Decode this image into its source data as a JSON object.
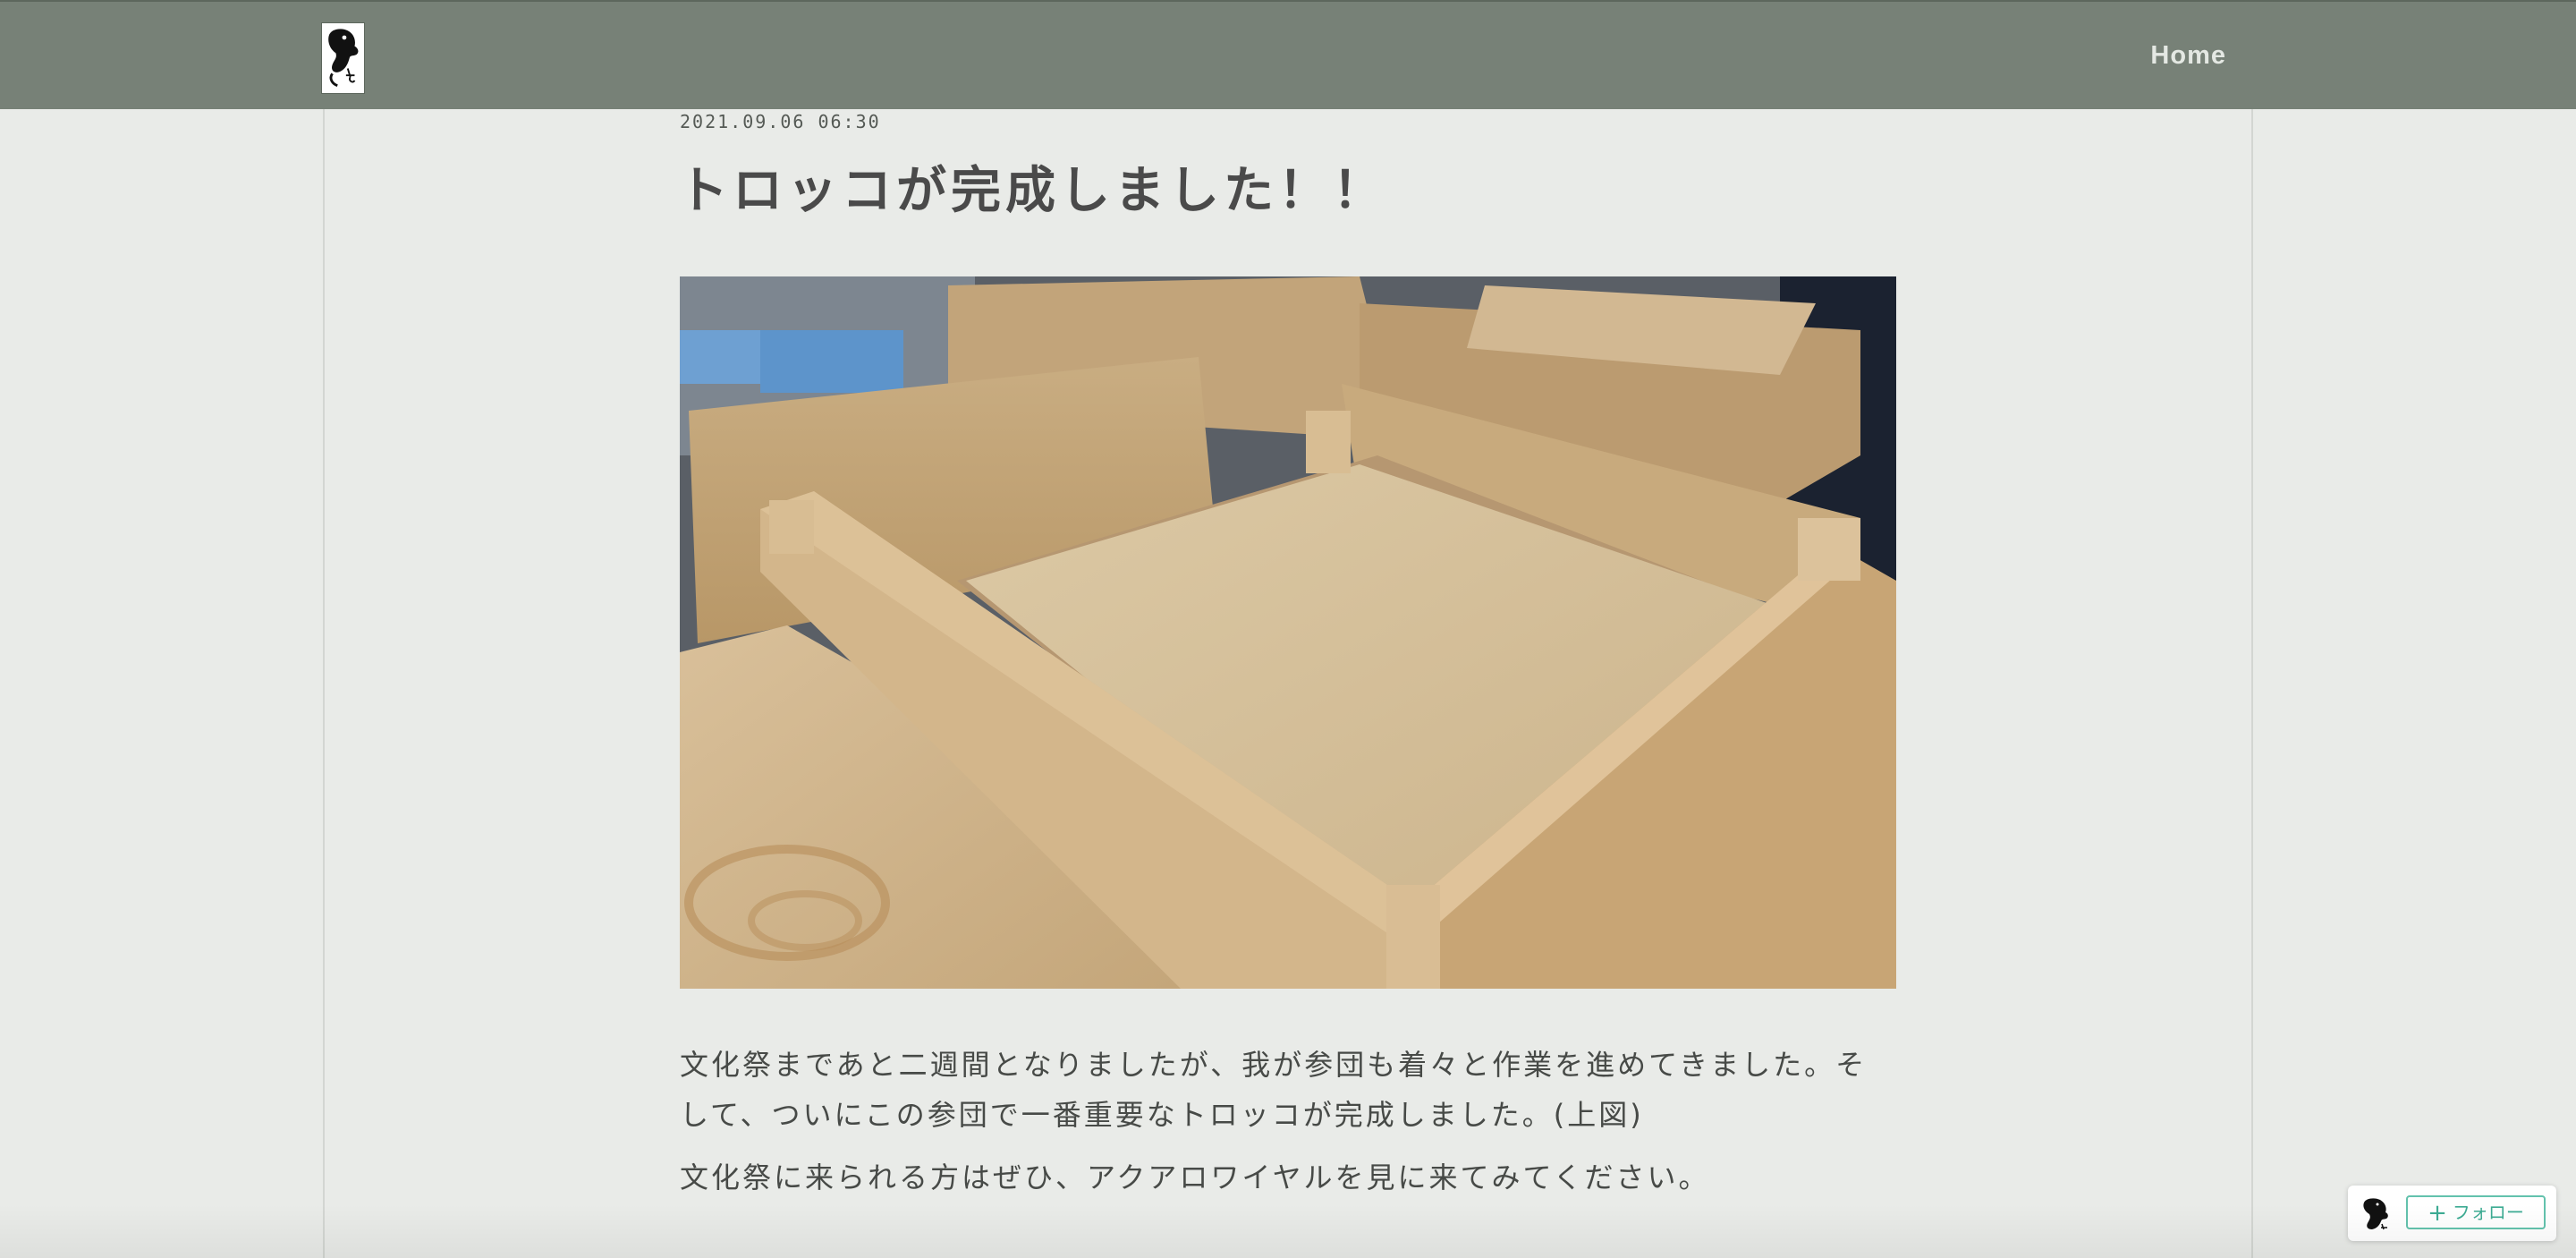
{
  "header": {
    "logo_alt": "site-logo",
    "nav": {
      "home_label": "Home"
    }
  },
  "post": {
    "date": "2021.09.06 06:30",
    "title": "トロッコが完成しました！！",
    "image_subject": "plywood-trolley-boxes",
    "paragraphs": [
      "文化祭まであと二週間となりましたが、我が参団も着々と作業を進めてきました。そして、ついにこの参団で一番重要なトロッコが完成しました。(上図)",
      "文化祭に来られる方はぜひ、アクアロワイヤルを見に来てみてください。"
    ]
  },
  "follow_widget": {
    "button_plus": "+",
    "button_label": "フォロー"
  },
  "colors": {
    "header_bg": "#778177",
    "page_bg": "#e9ebe8",
    "follow_accent": "#3dab93"
  }
}
